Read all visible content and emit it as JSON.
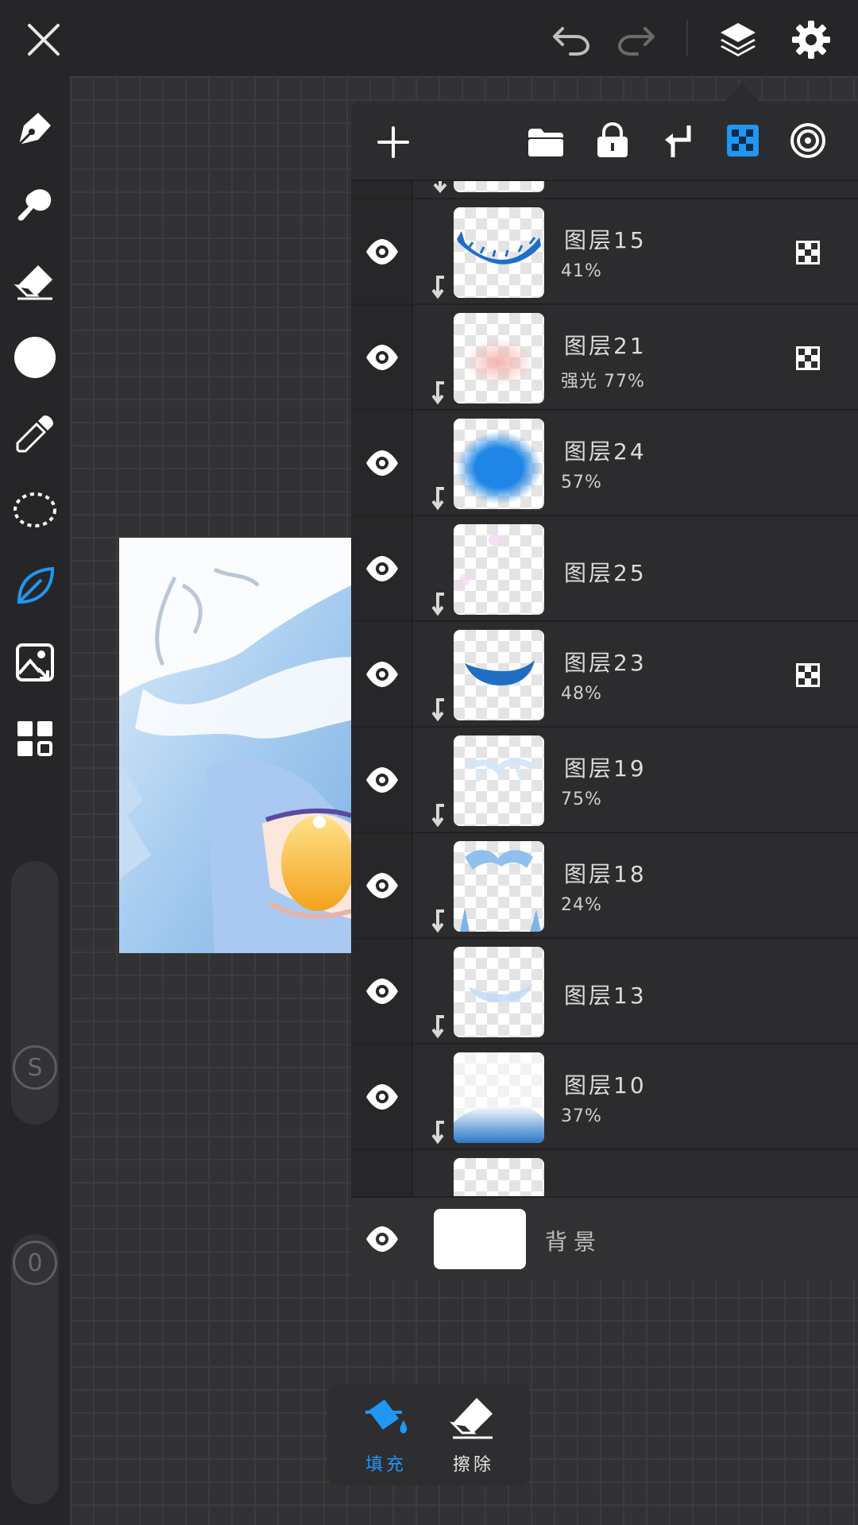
{
  "layers": [
    {
      "name": "图层15",
      "opacity": "41%",
      "flag": true,
      "thumb": "blue-lashes"
    },
    {
      "name": "图层21",
      "opacity": "强光  77%",
      "flag": true,
      "thumb": "pink-blush"
    },
    {
      "name": "图层24",
      "opacity": "57%",
      "flag": false,
      "thumb": "blue-blob"
    },
    {
      "name": "图层25",
      "opacity": "",
      "flag": false,
      "thumb": "faint-pink"
    },
    {
      "name": "图层23",
      "opacity": "48%",
      "flag": true,
      "thumb": "blue-curve"
    },
    {
      "name": "图层19",
      "opacity": "75%",
      "flag": false,
      "thumb": "light-strands"
    },
    {
      "name": "图层18",
      "opacity": "24%",
      "flag": false,
      "thumb": "hair-strands"
    },
    {
      "name": "图层13",
      "opacity": "",
      "flag": false,
      "thumb": "faint-blue"
    },
    {
      "name": "图层10",
      "opacity": "37%",
      "flag": false,
      "thumb": "blue-bottom"
    }
  ],
  "background_layer": {
    "name": "背景"
  },
  "bottom_tools": {
    "fill_label": "填充",
    "erase_label": "擦除"
  },
  "brush_opacity_value": "0",
  "colors": {
    "accent": "#2196f3",
    "panel": "#2c2c2e",
    "topbar": "#262628"
  }
}
